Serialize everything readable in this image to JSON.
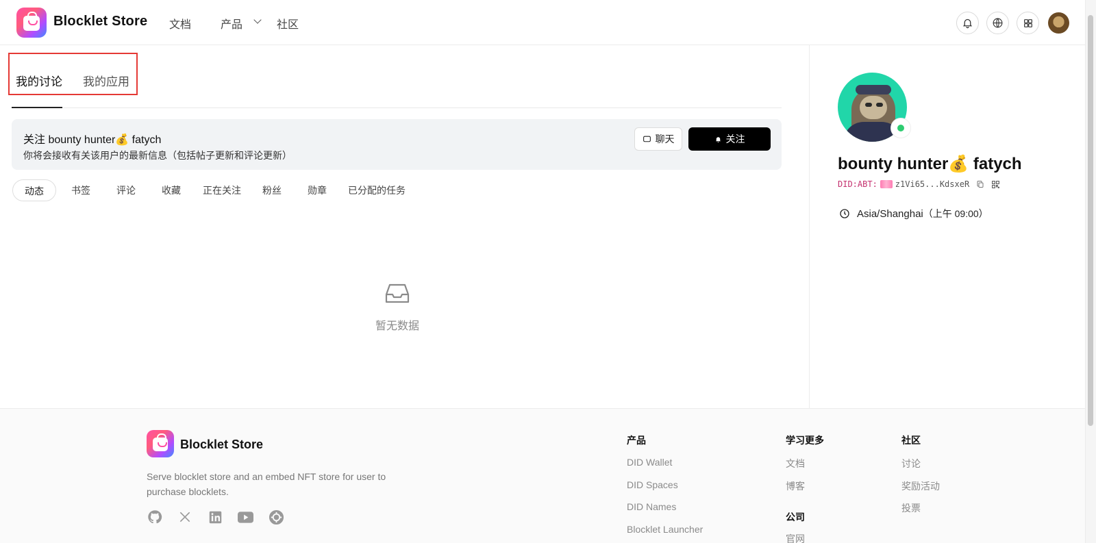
{
  "header": {
    "brand": "Blocklet Store",
    "nav": [
      {
        "label": "文档"
      },
      {
        "label": "产品"
      },
      {
        "label": "社区"
      }
    ]
  },
  "tabs": {
    "items": [
      "我的讨论",
      "我的应用"
    ],
    "active": "我的讨论"
  },
  "follow_card": {
    "title": "关注 bounty hunter💰 fatych",
    "description": "你将会接收有关该用户的最新信息（包括帖子更新和评论更新）",
    "chat_label": "聊天",
    "follow_label": "关注"
  },
  "sub_tabs": [
    "动态",
    "书签",
    "评论",
    "收藏",
    "正在关注",
    "粉丝",
    "勋章",
    "已分配的任务"
  ],
  "active_sub_tab": "动态",
  "empty_text": "暂无数据",
  "profile": {
    "name": "bounty hunter💰 fatych",
    "did_prefix": "DID:ABT:",
    "did_address": "z1Vi65...KdsxeR",
    "timezone": "Asia/Shanghai",
    "local_time": "（上午 09:00）"
  },
  "footer": {
    "brand": "Blocklet Store",
    "description": "Serve blocklet store and an embed NFT store for user to purchase blocklets.",
    "columns": [
      {
        "heading": "产品",
        "items": [
          "DID Wallet",
          "DID Spaces",
          "DID Names",
          "Blocklet Launcher"
        ]
      },
      {
        "heading": "学习更多",
        "items": [
          "文档",
          "博客"
        ]
      },
      {
        "heading": "公司",
        "items": [
          "官网"
        ]
      },
      {
        "heading": "社区",
        "items": [
          "讨论",
          "奖励活动",
          "投票"
        ]
      }
    ]
  },
  "colors": {
    "accent": "#000000",
    "highlight_box": "#e53935",
    "online": "#2ecc71",
    "avatar_bg": "#21d6a9"
  }
}
